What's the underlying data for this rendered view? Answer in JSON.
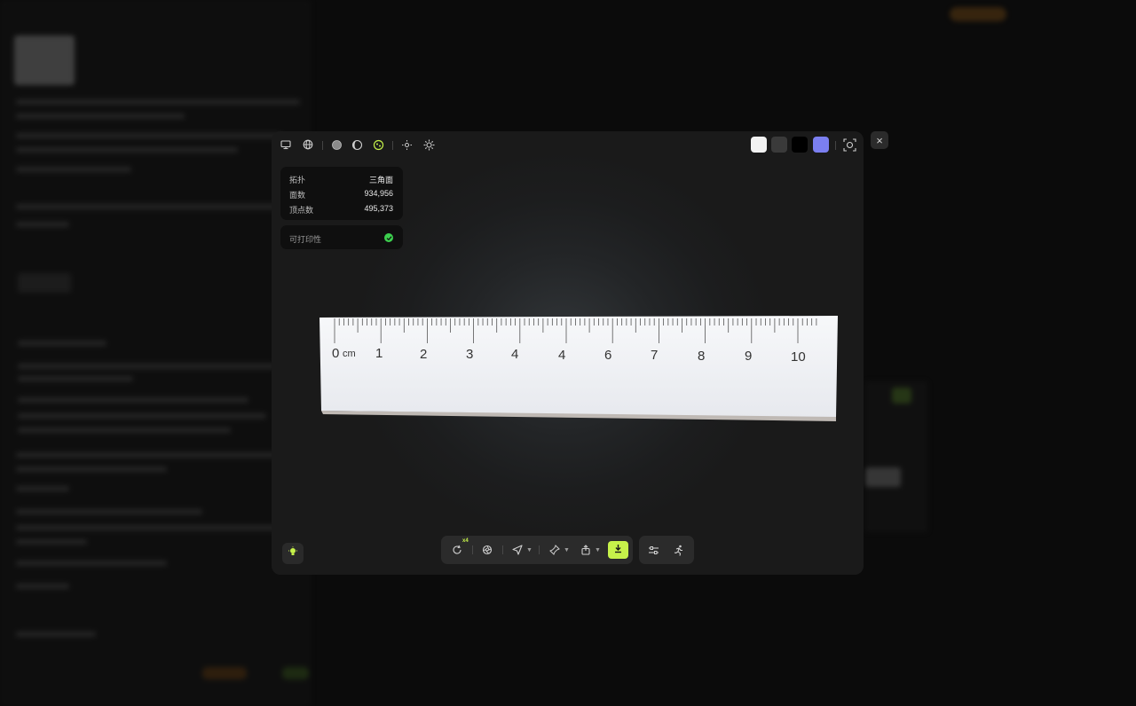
{
  "toolbar": {
    "icons": [
      "monitor-icon",
      "globe-icon",
      "solid-shade-icon",
      "outline-shade-icon",
      "texture-shade-icon",
      "light-dim-icon",
      "light-bright-icon",
      "screenshot-icon"
    ],
    "background_swatches": [
      "#f2f2f2",
      "#3a3a3a",
      "#000000",
      "#7b7ff0"
    ]
  },
  "close_label": "×",
  "mesh_info": {
    "rows": [
      {
        "label": "拓扑",
        "value": "三角面"
      },
      {
        "label": "面数",
        "value": "934,956"
      },
      {
        "label": "顶点数",
        "value": "495,373"
      }
    ]
  },
  "printability": {
    "label": "可打印性",
    "status": "ok"
  },
  "ruler": {
    "unit": "cm",
    "labels": [
      "0",
      "1",
      "2",
      "3",
      "4",
      "4",
      "6",
      "7",
      "8",
      "9",
      "10"
    ]
  },
  "bottom_toolbar": {
    "rotate_badge": "x4",
    "icons": [
      "rotate-icon",
      "aperture-icon",
      "send-icon",
      "pin-icon",
      "share-icon",
      "download-icon",
      "sliders-icon",
      "run-icon"
    ],
    "accent": "#c6f24a"
  }
}
